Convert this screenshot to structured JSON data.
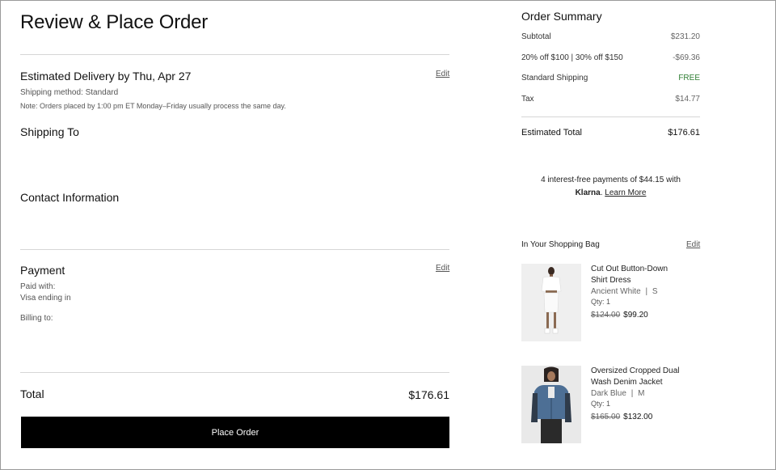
{
  "page_title": "Review & Place Order",
  "delivery": {
    "title": "Estimated Delivery by Thu, Apr 27",
    "edit": "Edit",
    "shipping_method": "Shipping method: Standard",
    "note": "Note: Orders placed by 1:00 pm ET Monday–Friday usually process the same day."
  },
  "shipping_to": {
    "title": "Shipping To"
  },
  "contact": {
    "title": "Contact Information"
  },
  "payment": {
    "title": "Payment",
    "edit": "Edit",
    "paid_with": "Paid with:",
    "card": "Visa ending in",
    "billing_to": "Billing to:"
  },
  "total": {
    "label": "Total",
    "value": "$176.61"
  },
  "place_order_label": "Place Order",
  "summary": {
    "title": "Order Summary",
    "rows": [
      {
        "label": "Subtotal",
        "value": "$231.20"
      },
      {
        "label": "20% off $100 | 30% off $150",
        "value": "-$69.36"
      },
      {
        "label": "Standard Shipping",
        "value": "FREE"
      },
      {
        "label": "Tax",
        "value": "$14.77"
      }
    ],
    "estimated_total_label": "Estimated Total",
    "estimated_total_value": "$176.61",
    "klarna_line": "4 interest-free payments of $44.15 with",
    "klarna_brand": "Klarna",
    "klarna_sep": ".",
    "learn_more": "Learn More"
  },
  "bag": {
    "title": "In Your Shopping Bag",
    "edit": "Edit",
    "items": [
      {
        "name_line1": "Cut Out Button-Down",
        "name_line2": "Shirt Dress",
        "color": "Ancient White",
        "sep": "|",
        "size": "S",
        "qty": "Qty: 1",
        "orig_price": "$124.00",
        "price": "$99.20"
      },
      {
        "name_line1": "Oversized Cropped Dual",
        "name_line2": "Wash Denim Jacket",
        "color": "Dark Blue",
        "sep": "|",
        "size": "M",
        "qty": "Qty: 1",
        "orig_price": "$165.00",
        "price": "$132.00"
      }
    ]
  },
  "colors": {
    "button_bg": "#000000",
    "free_green": "#2e7d32"
  }
}
